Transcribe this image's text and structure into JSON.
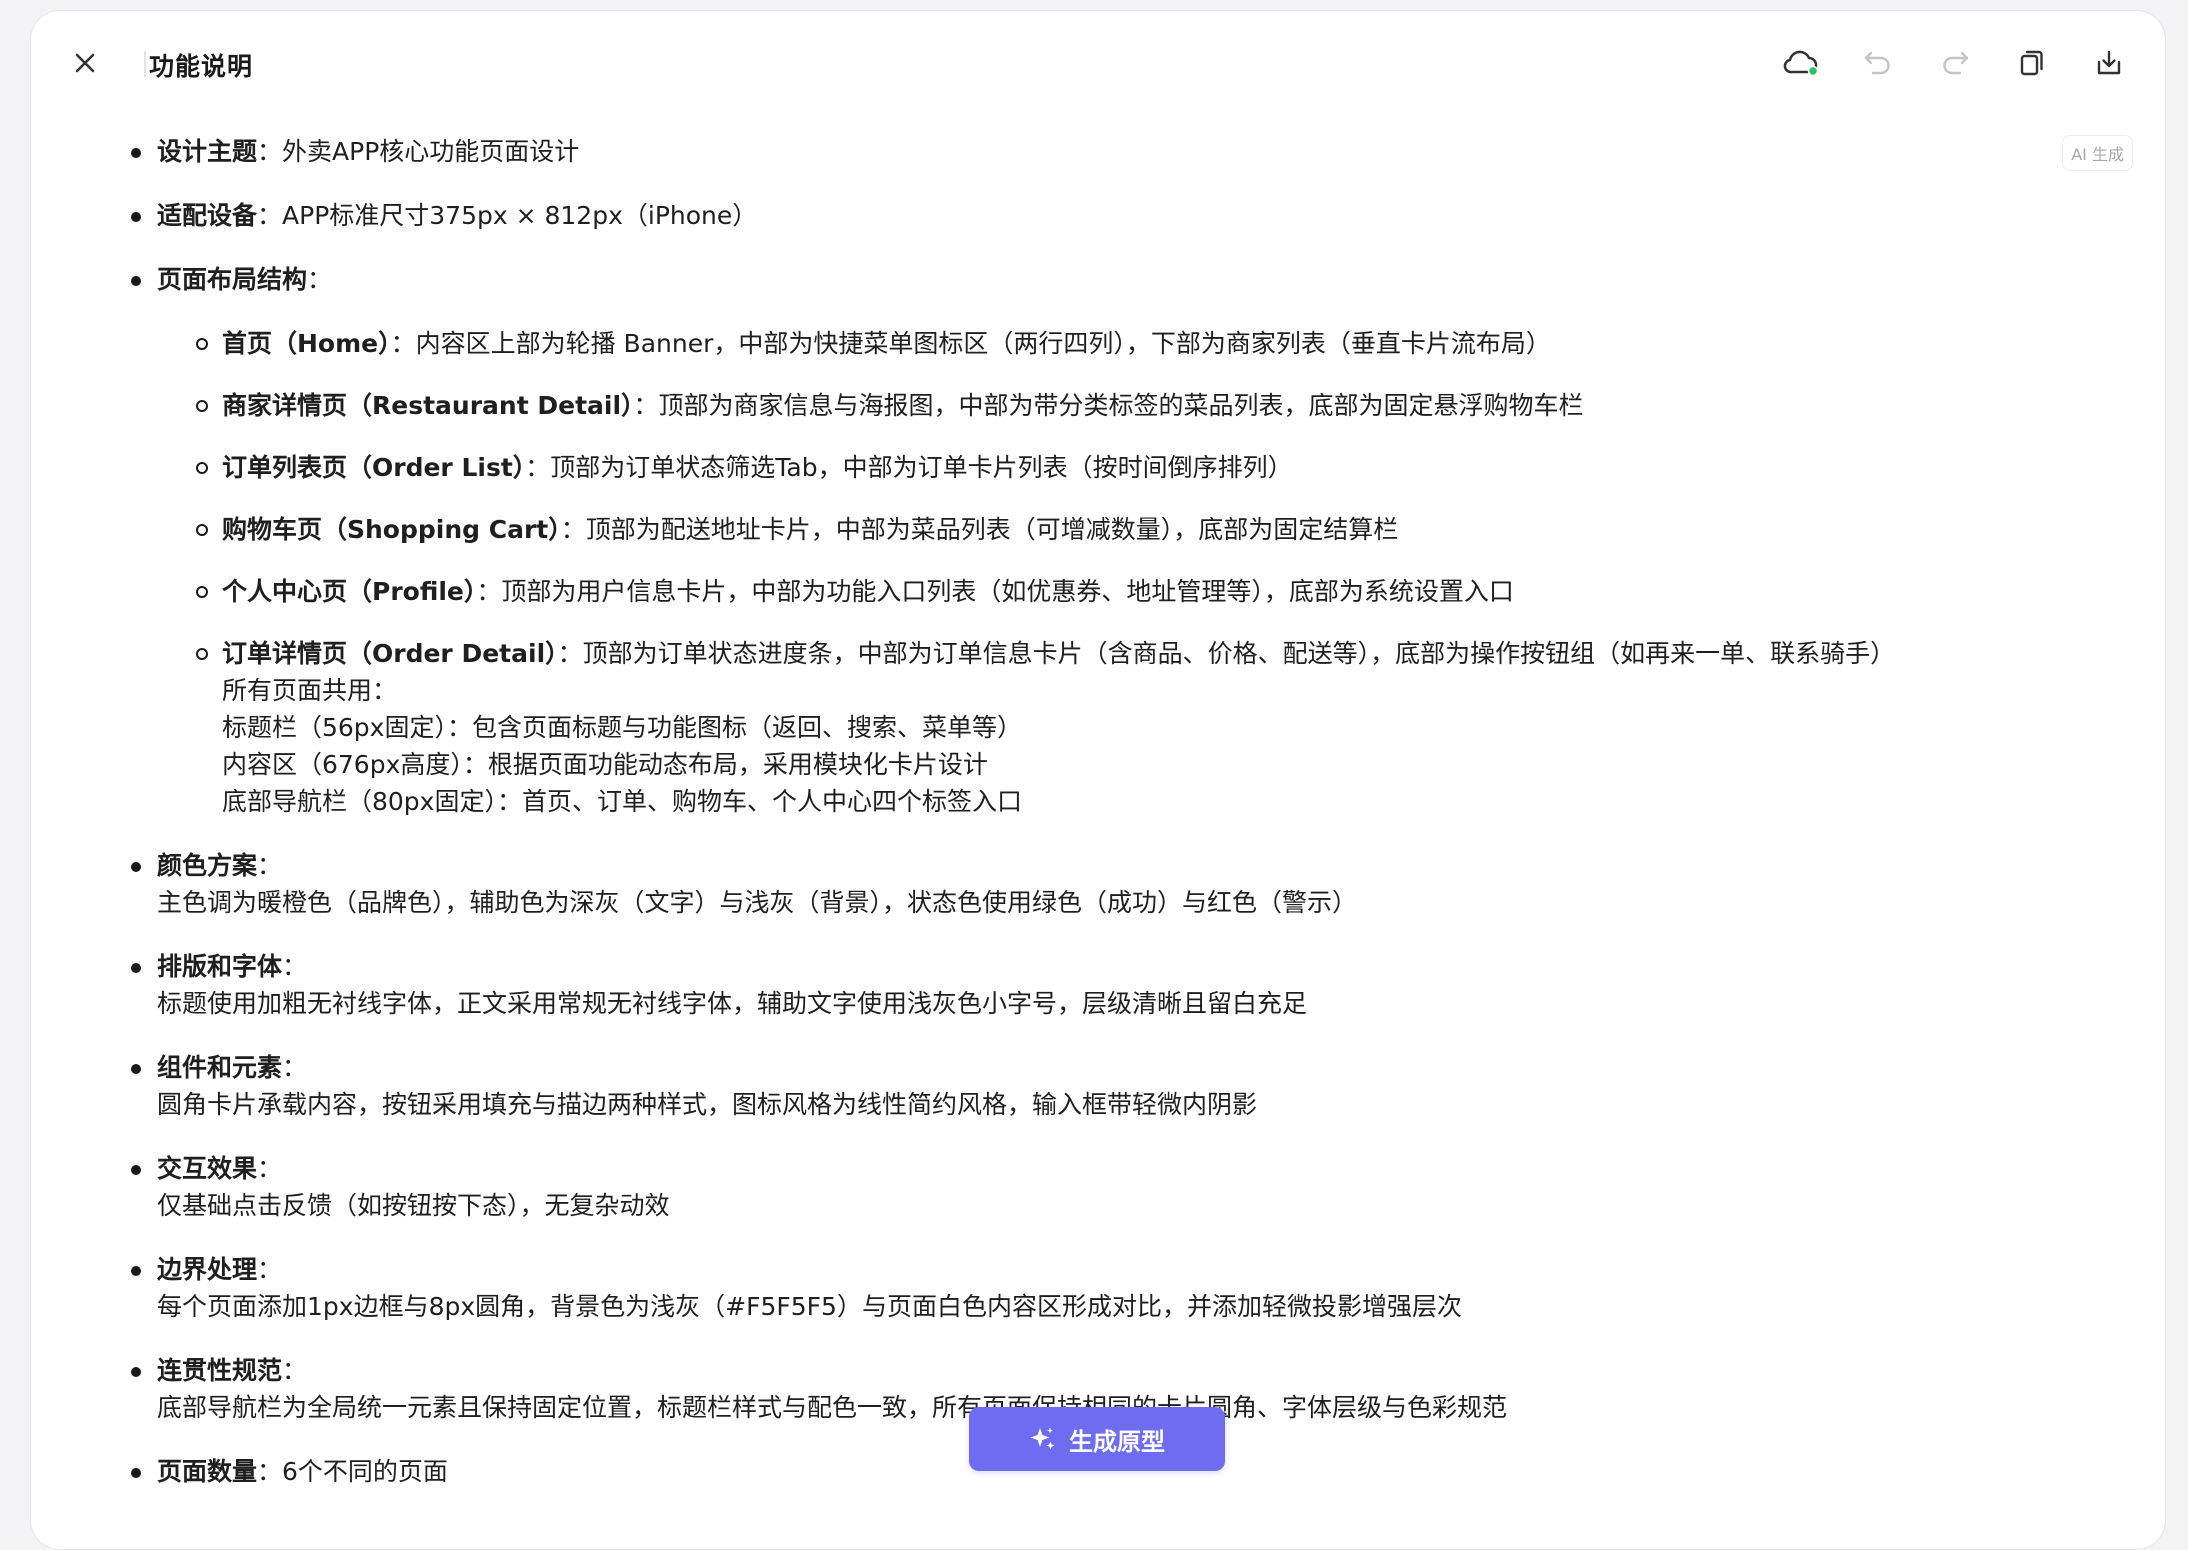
{
  "header": {
    "title": "功能说明",
    "icons": [
      "close-icon",
      "cloud-sync-icon",
      "undo-icon",
      "redo-icon",
      "copy-icon",
      "download-icon"
    ]
  },
  "ai_tag": "AI 生成",
  "content": {
    "items": [
      {
        "label": "设计主题",
        "text": "：外卖APP核心功能页面设计"
      },
      {
        "label": "适配设备",
        "text": "：APP标准尺寸375px × 812px（iPhone）"
      },
      {
        "label": "页面布局结构",
        "text": "：",
        "sub": [
          {
            "label": "首页（Home）",
            "text": "：内容区上部为轮播 Banner，中部为快捷菜单图标区（两行四列），下部为商家列表（垂直卡片流布局）"
          },
          {
            "label": "商家详情页（Restaurant Detail）",
            "text": "：顶部为商家信息与海报图，中部为带分类标签的菜品列表，底部为固定悬浮购物车栏"
          },
          {
            "label": "订单列表页（Order List）",
            "text": "：顶部为订单状态筛选Tab，中部为订单卡片列表（按时间倒序排列）"
          },
          {
            "label": "购物车页（Shopping Cart）",
            "text": "：顶部为配送地址卡片，中部为菜品列表（可增减数量），底部为固定结算栏"
          },
          {
            "label": "个人中心页（Profile）",
            "text": "：顶部为用户信息卡片，中部为功能入口列表（如优惠券、地址管理等），底部为系统设置入口"
          },
          {
            "label": "订单详情页（Order Detail）",
            "text": "：顶部为订单状态进度条，中部为订单信息卡片（含商品、价格、配送等），底部为操作按钮组（如再来一单、联系骑手）",
            "extra": [
              "所有页面共用：",
              "标题栏（56px固定）：包含页面标题与功能图标（返回、搜索、菜单等）",
              "内容区（676px高度）：根据页面功能动态布局，采用模块化卡片设计",
              "底部导航栏（80px固定）：首页、订单、购物车、个人中心四个标签入口"
            ]
          }
        ]
      },
      {
        "label": "颜色方案",
        "text": "：",
        "desc": "主色调为暖橙色（品牌色），辅助色为深灰（文字）与浅灰（背景），状态色使用绿色（成功）与红色（警示）"
      },
      {
        "label": "排版和字体",
        "text": "：",
        "desc": "标题使用加粗无衬线字体，正文采用常规无衬线字体，辅助文字使用浅灰色小字号，层级清晰且留白充足"
      },
      {
        "label": "组件和元素",
        "text": "：",
        "desc": "圆角卡片承载内容，按钮采用填充与描边两种样式，图标风格为线性简约风格，输入框带轻微内阴影"
      },
      {
        "label": "交互效果",
        "text": "：",
        "desc": "仅基础点击反馈（如按钮按下态），无复杂动效"
      },
      {
        "label": "边界处理",
        "text": "：",
        "desc": "每个页面添加1px边框与8px圆角，背景色为浅灰（#F5F5F5）与页面白色内容区形成对比，并添加轻微投影增强层次"
      },
      {
        "label": "连贯性规范",
        "text": "：",
        "desc": "底部导航栏为全局统一元素且保持固定位置，标题栏样式与配色一致，所有页面保持相同的卡片圆角、字体层级与色彩规范"
      },
      {
        "label": "页面数量",
        "text": "：6个不同的页面"
      }
    ]
  },
  "generate_button": {
    "label": "生成原型",
    "icon": "sparkle-icon"
  },
  "colors": {
    "accent": "#6e6cf0",
    "sync_dot": "#22c55e",
    "disabled_icon": "#c4c4c8"
  }
}
